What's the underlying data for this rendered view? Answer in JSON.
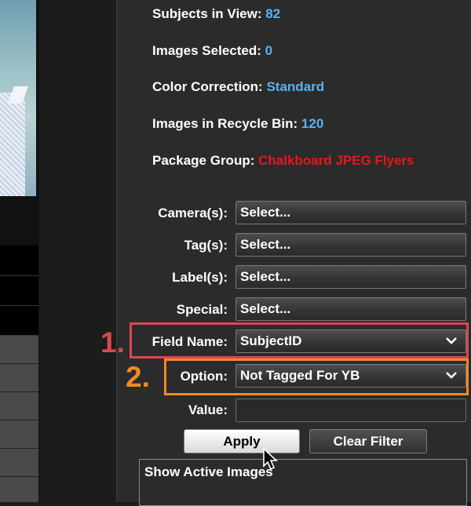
{
  "stats": [
    {
      "label": "Subjects in View:",
      "value": "82"
    },
    {
      "label": "Images Selected:",
      "value": "0"
    },
    {
      "label": "Color Correction:",
      "value": "Standard"
    },
    {
      "label": "Images in Recycle Bin:",
      "value": "120"
    },
    {
      "label": "Package Group:",
      "value": "Chalkboard JPEG Flyers"
    }
  ],
  "filters": {
    "camera": {
      "label": "Camera(s):",
      "value": "Select..."
    },
    "tag": {
      "label": "Tag(s):",
      "value": "Select..."
    },
    "label": {
      "label": "Label(s):",
      "value": "Select..."
    },
    "special": {
      "label": "Special:",
      "value": "Select..."
    },
    "field_name": {
      "label": "Field Name:",
      "value": "SubjectID"
    },
    "option": {
      "label": "Option:",
      "value": "Not Tagged For YB"
    },
    "value": {
      "label": "Value:",
      "value": ""
    }
  },
  "annotations": {
    "step1": "1.",
    "step2": "2."
  },
  "buttons": {
    "apply": "Apply",
    "clear_filter": "Clear Filter"
  },
  "active_images": "Show Active Images",
  "colors": {
    "stat_value": "#58b4f0",
    "package_value": "#e8161b",
    "highlight1": "#d8484e",
    "highlight2": "#ef8a23"
  },
  "icons": [
    "chevron-down-icon",
    "mouse-pointer-icon"
  ]
}
